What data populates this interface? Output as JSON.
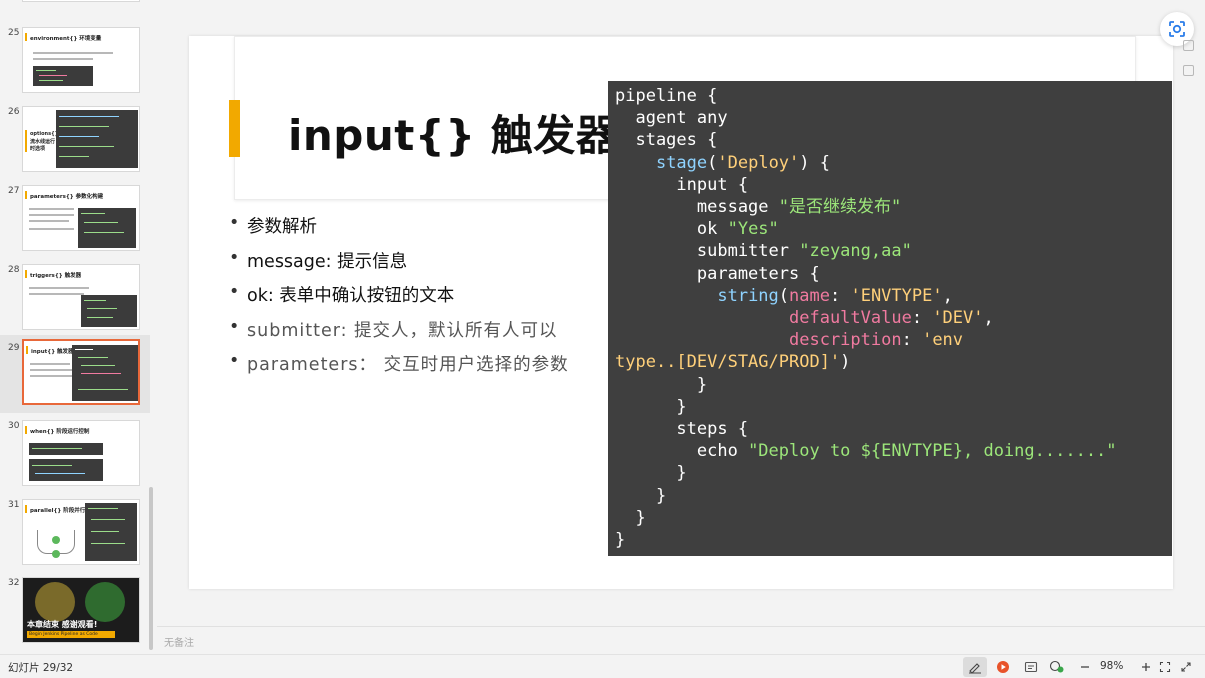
{
  "sidebar": {
    "thumbnails": [
      {
        "num": "25",
        "title": "environment{} 环境变量"
      },
      {
        "num": "26",
        "title": "options{}"
      },
      {
        "num": "27",
        "title": "parameters{} 参数化构建"
      },
      {
        "num": "28",
        "title": "triggers{} 触发器"
      },
      {
        "num": "29",
        "title": "input{} 触发器"
      },
      {
        "num": "30",
        "title": "when{} 阶段运行控制"
      },
      {
        "num": "31",
        "title": "parallel{} 阶段并行"
      },
      {
        "num": "32",
        "title": "本章结束 感谢观看!",
        "subtitle": "Begin Jenkins Pipeline as Code"
      }
    ],
    "thumb26_sub": [
      "options{}",
      "流水线运行",
      "时选项"
    ]
  },
  "slide": {
    "title": "input{} 触发器",
    "bullets": [
      "参数解析",
      "message: 提示信息",
      "ok: 表单中确认按钮的文本",
      "submitter: 提交人，默认所有人可以",
      "parameters： 交互时用户选择的参数"
    ]
  },
  "code_lines": [
    "pipeline {",
    "  agent any",
    "  stages {",
    "    stage('Deploy') {",
    "      input {",
    "        message \"是否继续发布\"",
    "        ok \"Yes\"",
    "        submitter \"zeyang,aa\"",
    "        parameters {",
    "          string(name: 'ENVTYPE',",
    "                 defaultValue: 'DEV',",
    "                 description: 'env",
    "type..[DEV/STAG/PROD]')",
    "        }",
    "      }",
    "      steps {",
    "        echo \"Deploy to ${ENVTYPE}, doing.......\"",
    "      }",
    "    }",
    "  }",
    "}"
  ],
  "notes": {
    "placeholder": "无备注"
  },
  "status": {
    "slide_counter": "幻灯片 29/32",
    "zoom": "98%"
  },
  "colors": {
    "accent": "#f2a900",
    "active_border": "#e8683a",
    "code_bg": "#3f3f3f"
  }
}
